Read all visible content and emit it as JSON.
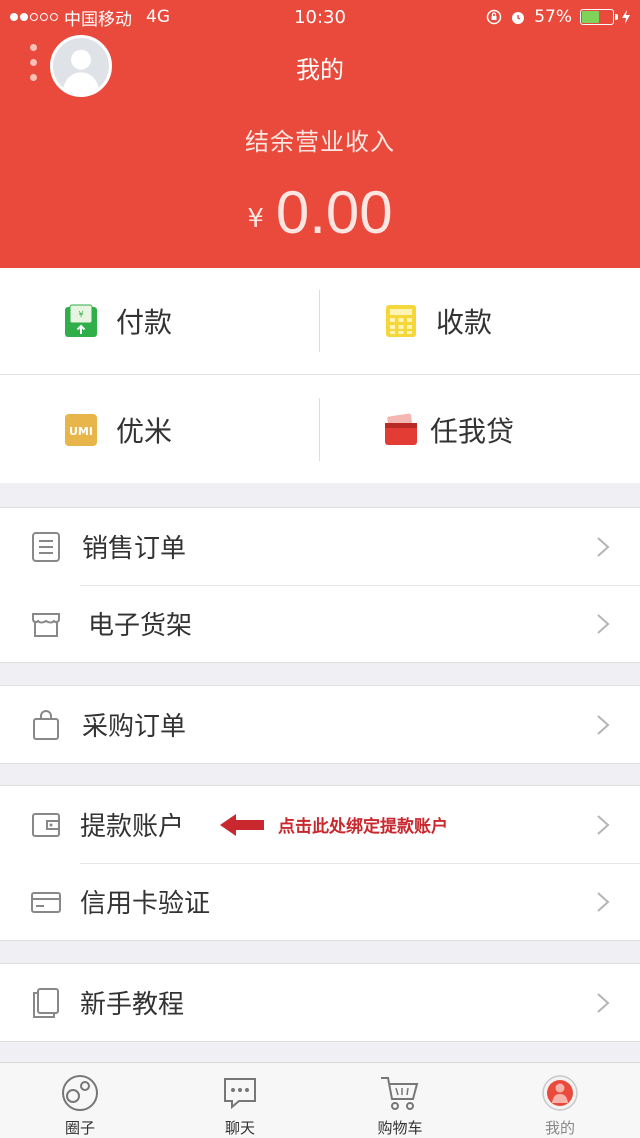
{
  "status_bar": {
    "carrier": "中国移动",
    "network": "4G",
    "time": "10:30",
    "battery": "57%"
  },
  "header": {
    "title": "我的",
    "balance_label": "结余营业收入",
    "currency": "¥",
    "balance": "0.00"
  },
  "quick_actions": [
    {
      "label": "付款",
      "icon": "payment-icon"
    },
    {
      "label": "收款",
      "icon": "calculator-icon"
    },
    {
      "label": "优米",
      "icon": "umi-icon"
    },
    {
      "label": "任我贷",
      "icon": "card-wallet-icon"
    }
  ],
  "menu_sections": [
    [
      {
        "label": "销售订单",
        "icon": "document-list-icon"
      },
      {
        "label": "电子货架",
        "icon": "store-icon"
      }
    ],
    [
      {
        "label": "采购订单",
        "icon": "shopping-bag-icon"
      }
    ],
    [
      {
        "label": "提款账户",
        "icon": "wallet-icon"
      },
      {
        "label": "信用卡验证",
        "icon": "credit-card-icon"
      }
    ],
    [
      {
        "label": "新手教程",
        "icon": "tutorial-pages-icon"
      }
    ]
  ],
  "hint": {
    "text": "点击此处绑定提款账户"
  },
  "tabbar": [
    {
      "label": "圈子",
      "icon": "circles-icon"
    },
    {
      "label": "聊天",
      "icon": "chat-icon"
    },
    {
      "label": "购物车",
      "icon": "cart-icon"
    },
    {
      "label": "我的",
      "icon": "profile-icon"
    }
  ],
  "colors": {
    "brand_red": "#e94a3c",
    "hint_red": "#c8282e",
    "background": "#efeff4"
  }
}
